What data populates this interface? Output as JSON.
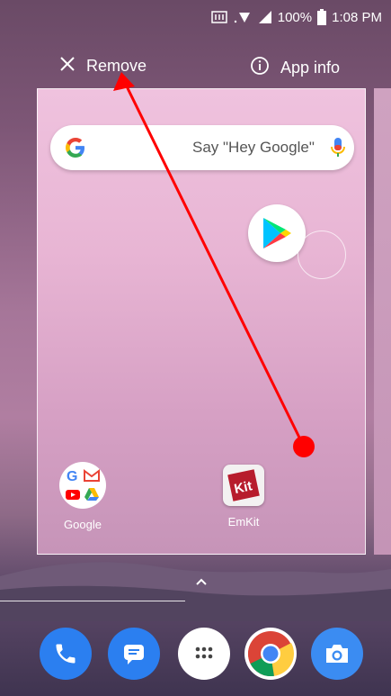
{
  "status_bar": {
    "battery": "100%",
    "time": "1:08 PM"
  },
  "actions": {
    "remove_label": "Remove",
    "app_info_label": "App info"
  },
  "card": {
    "search_placeholder": "Say \"Hey Google\"",
    "apps": [
      {
        "label": "Google",
        "icon": "google-folder-icon"
      },
      {
        "label": "EmKit",
        "icon": "emkit-icon"
      }
    ]
  },
  "dock": [
    {
      "icon": "phone-icon"
    },
    {
      "icon": "messages-icon"
    },
    {
      "icon": "app-drawer-icon"
    },
    {
      "icon": "chrome-icon"
    },
    {
      "icon": "camera-icon"
    }
  ],
  "colors": {
    "annotation": "#ff0000",
    "dock_blue": "#2b7ff0"
  }
}
